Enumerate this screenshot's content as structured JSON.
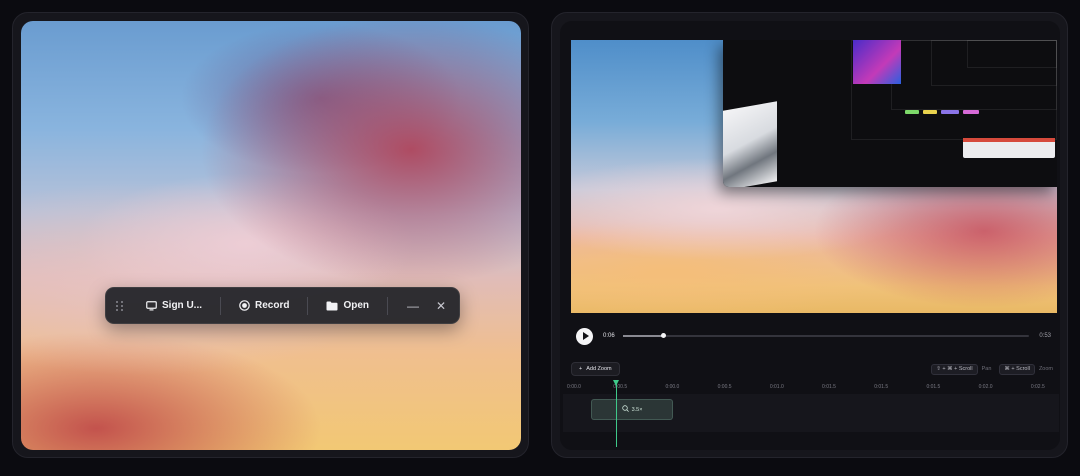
{
  "recorder": {
    "toolbar": {
      "source_label": "Sign U...",
      "record_label": "Record",
      "open_label": "Open",
      "minimize_glyph": "—",
      "close_glyph": "✕"
    },
    "icons": [
      "drag-handle-icon",
      "monitor-icon",
      "record-icon",
      "folder-icon",
      "minimize-icon",
      "close-icon"
    ]
  },
  "editor": {
    "playback": {
      "current_time": "0:06",
      "end_time": "0:53",
      "progress": 0.1
    },
    "controls": {
      "add_zoom_label": "Add Zoom",
      "hints": [
        {
          "keys": "⇧ + ⌘ + Scroll",
          "label": "Pan"
        },
        {
          "keys": "⌘ + Scroll",
          "label": "Zoom"
        }
      ]
    },
    "timeline": {
      "ticks": [
        "0:00.0",
        "0:00.5",
        "0:00.0",
        "0:00.5",
        "0:01.0",
        "0:01.5",
        "0:01.5",
        "0:01.5",
        "0:02.0",
        "0:02.5"
      ],
      "zoom_segment_label": "3.5×"
    }
  },
  "colors": {
    "accent_green": "#3fc98a",
    "toolbar_bg": "#26262c",
    "page_bg": "#0b0b10"
  }
}
